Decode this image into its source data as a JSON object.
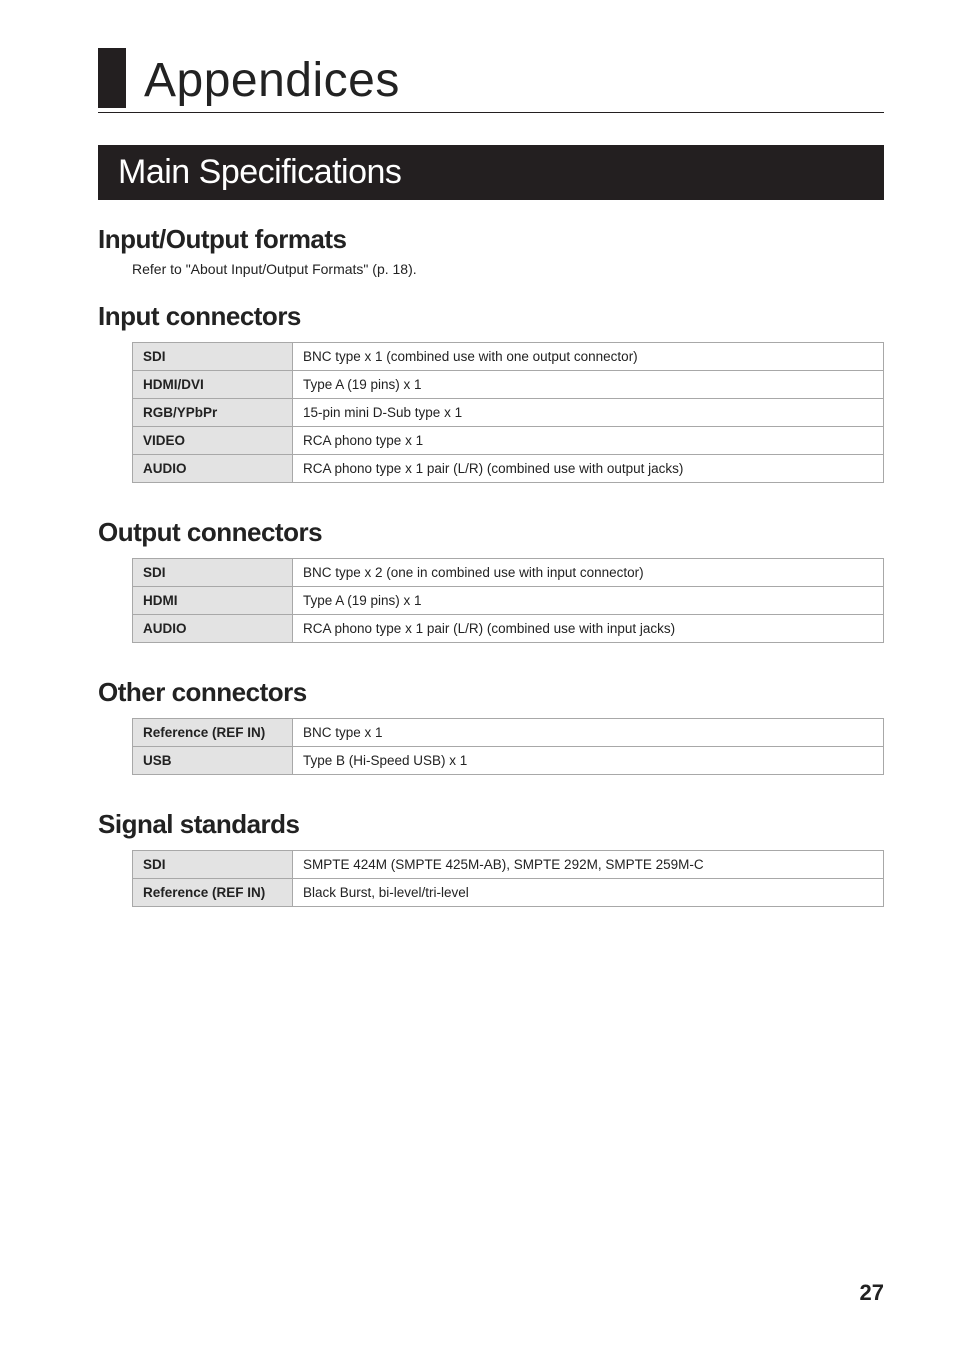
{
  "page_title": "Appendices",
  "section_title": "Main Specifications",
  "io_formats": {
    "heading": "Input/Output formats",
    "note": "Refer to \"About Input/Output Formats\" (p. 18)."
  },
  "input_connectors": {
    "heading": "Input connectors",
    "rows": [
      {
        "label": "SDI",
        "value": "BNC type x 1 (combined use with one output connector)"
      },
      {
        "label": "HDMI/DVI",
        "value": "Type A (19 pins) x 1"
      },
      {
        "label": "RGB/YPbPr",
        "value": "15-pin mini D-Sub type x 1"
      },
      {
        "label": "VIDEO",
        "value": "RCA phono type x 1"
      },
      {
        "label": "AUDIO",
        "value": "RCA phono type x 1 pair (L/R) (combined use with output jacks)"
      }
    ]
  },
  "output_connectors": {
    "heading": "Output connectors",
    "rows": [
      {
        "label": "SDI",
        "value": "BNC type x 2 (one in combined use with input connector)"
      },
      {
        "label": "HDMI",
        "value": "Type A (19 pins) x 1"
      },
      {
        "label": "AUDIO",
        "value": "RCA phono type x 1 pair (L/R) (combined use with input jacks)"
      }
    ]
  },
  "other_connectors": {
    "heading": "Other connectors",
    "rows": [
      {
        "label": "Reference (REF IN)",
        "value": "BNC type x 1"
      },
      {
        "label": "USB",
        "value": "Type B (Hi-Speed USB) x 1"
      }
    ]
  },
  "signal_standards": {
    "heading": "Signal standards",
    "rows": [
      {
        "label": "SDI",
        "value": "SMPTE 424M (SMPTE 425M-AB), SMPTE 292M, SMPTE 259M-C"
      },
      {
        "label": "Reference (REF IN)",
        "value": "Black Burst, bi-level/tri-level"
      }
    ]
  },
  "page_number": "27"
}
